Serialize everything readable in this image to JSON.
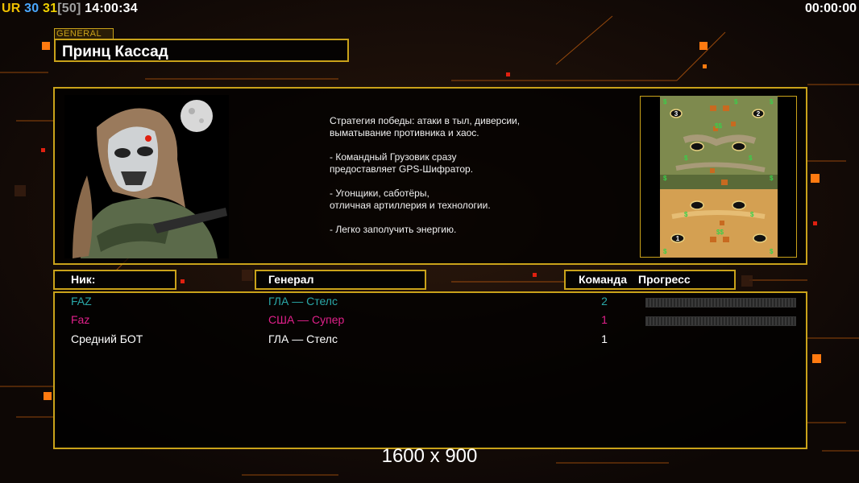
{
  "hud": {
    "tag": "UR",
    "num1": "30",
    "num2": "31",
    "num3": "[50]",
    "clock": "14:00:34",
    "timer": "00:00:00"
  },
  "general": {
    "tag": "GENERAL",
    "name": "Принц Кассад"
  },
  "description": [
    "Стратегия победы: атаки в тыл, диверсии,\n выматывание противника и хаос.",
    "- Командный Грузовик сразу\nпредоставляет GPS-Шифратор.",
    "- Угонщики, саботёры,\nотличная артиллерия и технологии.",
    "- Легко заполучить энергию."
  ],
  "map": {
    "slot_labels": [
      "3",
      "2",
      "1"
    ]
  },
  "headers": {
    "nick": "Ник:",
    "general": "Генерал",
    "team": "Команда",
    "progress": "Прогресс"
  },
  "players": [
    {
      "nick": "FAZ",
      "general": "ГЛА — Стелс",
      "team": "2",
      "color": "#2aa8a8",
      "progress": 0
    },
    {
      "nick": "Faz",
      "general": "США — Супер",
      "team": "1",
      "color": "#e0208a",
      "progress": 0
    },
    {
      "nick": "Средний БОТ",
      "general": "ГЛА — Стелс",
      "team": "1",
      "color": "#ffffff"
    }
  ],
  "resolution": "1600 x 900",
  "colors": {
    "accent": "#c9a21a",
    "orange": "#ff7a10",
    "hud_tag": "#f0c000",
    "hud_num1": "#4aa8ff",
    "hud_num2": "#f0d000",
    "hud_num3": "#a0a0a0"
  }
}
